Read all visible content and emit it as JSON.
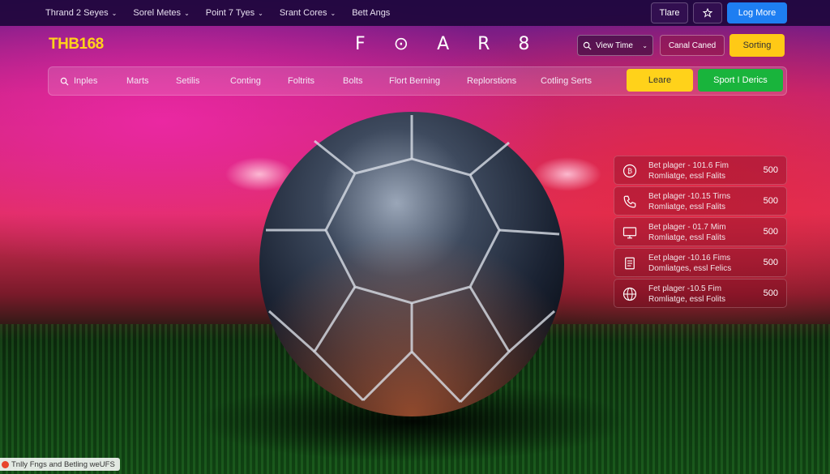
{
  "topbar": {
    "menu": [
      {
        "label": "Thrand 2 Seyes",
        "chevron": true
      },
      {
        "label": "Sorel Metes",
        "chevron": true
      },
      {
        "label": "Point 7 Tyes",
        "chevron": true
      },
      {
        "label": "Srant Cores",
        "chevron": true
      },
      {
        "label": "Bett Angs",
        "chevron": false
      }
    ],
    "tiare_label": "Tlare",
    "star_icon": "star-icon",
    "login_label": "Log More",
    "login_color": "#1e7ef2"
  },
  "header": {
    "logo": "THB168",
    "logo_color": "#ffd21a",
    "center_logo": "F ⊙ A R 8",
    "view_time_label": "View Time",
    "canal_label": "Canal Caned",
    "sorting_label": "Sorting",
    "sorting_color": "#ffc916"
  },
  "nav": {
    "search_label": "Inples",
    "items": [
      "Marts",
      "Setilis",
      "Conting",
      "Foltrits",
      "Bolts",
      "Flort Berning",
      "Replorstions",
      "Cotling Serts"
    ],
    "leare_label": "Leare",
    "leare_color": "#ffd21a",
    "sport_label": "Sport I Derics",
    "sport_color": "#19b43c"
  },
  "side_list": [
    {
      "icon": "bitcoin-icon",
      "line1": "Bet plager - 101.6 Fim",
      "line2": "Romliatge, essl Falits",
      "value": "500"
    },
    {
      "icon": "phone-icon",
      "line1": "Bet plager -10.15 Tirns",
      "line2": "Romliatge, essl Falits",
      "value": "500"
    },
    {
      "icon": "monitor-icon",
      "line1": "Bet plager - 01.7 Mim",
      "line2": "Romliatge, essl Falits",
      "value": "500"
    },
    {
      "icon": "document-icon",
      "line1": "Eet plager -10.16 Fims",
      "line2": "Domliatges, essl Felics",
      "value": "500"
    },
    {
      "icon": "globe-icon",
      "line1": "Fet plager -10.5 Fim",
      "line2": "Romliatge, essl Folits",
      "value": "500"
    }
  ],
  "footer": {
    "text": "Tnlly Fngs and Betling weUFS"
  }
}
